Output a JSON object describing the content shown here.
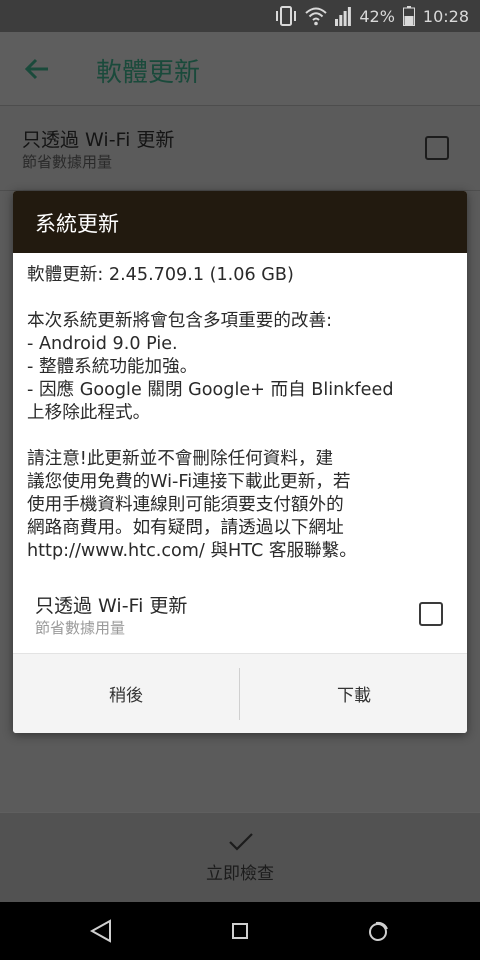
{
  "status_bar": {
    "battery": "42%",
    "time": "10:28",
    "icons": [
      "vibrate-icon",
      "wifi-icon",
      "signal-icon",
      "battery-icon"
    ]
  },
  "app_bar": {
    "title": "軟體更新",
    "back_icon": "arrow-left-icon"
  },
  "setting_row": {
    "title": "只透過 Wi-Fi 更新",
    "subtitle": "節省數據用量"
  },
  "dialog": {
    "title": "系統更新",
    "version_line": "軟體更新: 2.45.709.1 (1.06 GB)",
    "intro": "本次系統更新將會包含多項重要的改善:",
    "items": [
      "- Android 9.0 Pie.",
      "- 整體系統功能加強。",
      "- 因應 Google 關閉 Google+ 而自 Blinkfeed",
      "上移除此程式。"
    ],
    "notice_lines": [
      "請注意!此更新並不會刪除任何資料，建",
      "議您使用免費的Wi-Fi連接下載此更新，若",
      "使用手機資料連線則可能須要支付額外的",
      "網路商費用。如有疑問，請透過以下網址",
      "http://www.htc.com/  與HTC 客服聯繫。"
    ],
    "option": {
      "title": "只透過 Wi-Fi 更新",
      "subtitle": "節省數據用量"
    },
    "later_label": "稍後",
    "download_label": "下載"
  },
  "bottom_action": {
    "label": "立即檢查",
    "icon": "check-icon"
  },
  "nav_bar": {
    "icons": [
      "back-triangle-icon",
      "home-square-icon",
      "recents-icon"
    ]
  },
  "colors": {
    "accent": "#1a4a3b",
    "dialog_header": "#221a0f",
    "scrim": "#5b5b5b"
  }
}
